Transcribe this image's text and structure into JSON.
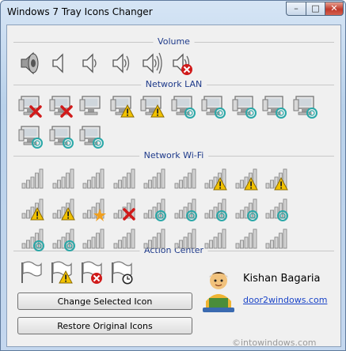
{
  "window": {
    "title": "Windows 7 Tray Icons Changer",
    "min": "–",
    "max": "□",
    "close": "✕"
  },
  "sections": {
    "volume": "Volume",
    "lan": "Network LAN",
    "wifi": "Network Wi-Fi",
    "action": "Action Center"
  },
  "buttons": {
    "change": "Change Selected Icon",
    "restore": "Restore Original Icons"
  },
  "author": {
    "name": "Kishan Bagaria",
    "site": "door2windows.com"
  },
  "watermark": "©intowindows.com",
  "colors": {
    "accent_text": "#1e3a8a",
    "error": "#d01a1a",
    "warning": "#f2c200",
    "teal": "#2aa8a8"
  },
  "icons": {
    "volume": [
      "speaker-3d-icon",
      "speaker-mute-icon",
      "speaker-low-icon",
      "speaker-medium-icon",
      "speaker-high-icon",
      "speaker-error-icon"
    ],
    "lan": [
      "lan-error-icon",
      "lan-error-icon",
      "lan-icon",
      "lan-warning-icon",
      "lan-warning-icon",
      "lan-activity-icon",
      "lan-activity-icon",
      "lan-activity-icon",
      "lan-activity-icon",
      "lan-activity-icon",
      "lan-activity-icon",
      "lan-activity-icon",
      "lan-activity-icon"
    ],
    "wifi": [
      "wifi-icon",
      "wifi-icon",
      "wifi-icon",
      "wifi-icon",
      "wifi-icon",
      "wifi-icon",
      "wifi-warning-icon",
      "wifi-warning-icon",
      "wifi-warning-icon",
      "wifi-warning-icon",
      "wifi-warning-icon",
      "wifi-star-icon",
      "wifi-error-icon",
      "wifi-searching-icon",
      "wifi-searching-icon",
      "wifi-searching-icon",
      "wifi-searching-icon",
      "wifi-searching-icon",
      "wifi-searching-icon",
      "wifi-searching-icon",
      "wifi-icon",
      "wifi-icon",
      "wifi-icon",
      "wifi-icon",
      "wifi-icon",
      "wifi-icon",
      "wifi-icon"
    ],
    "action": [
      "flag-icon",
      "flag-warning-icon",
      "flag-error-icon",
      "flag-clock-icon"
    ]
  }
}
